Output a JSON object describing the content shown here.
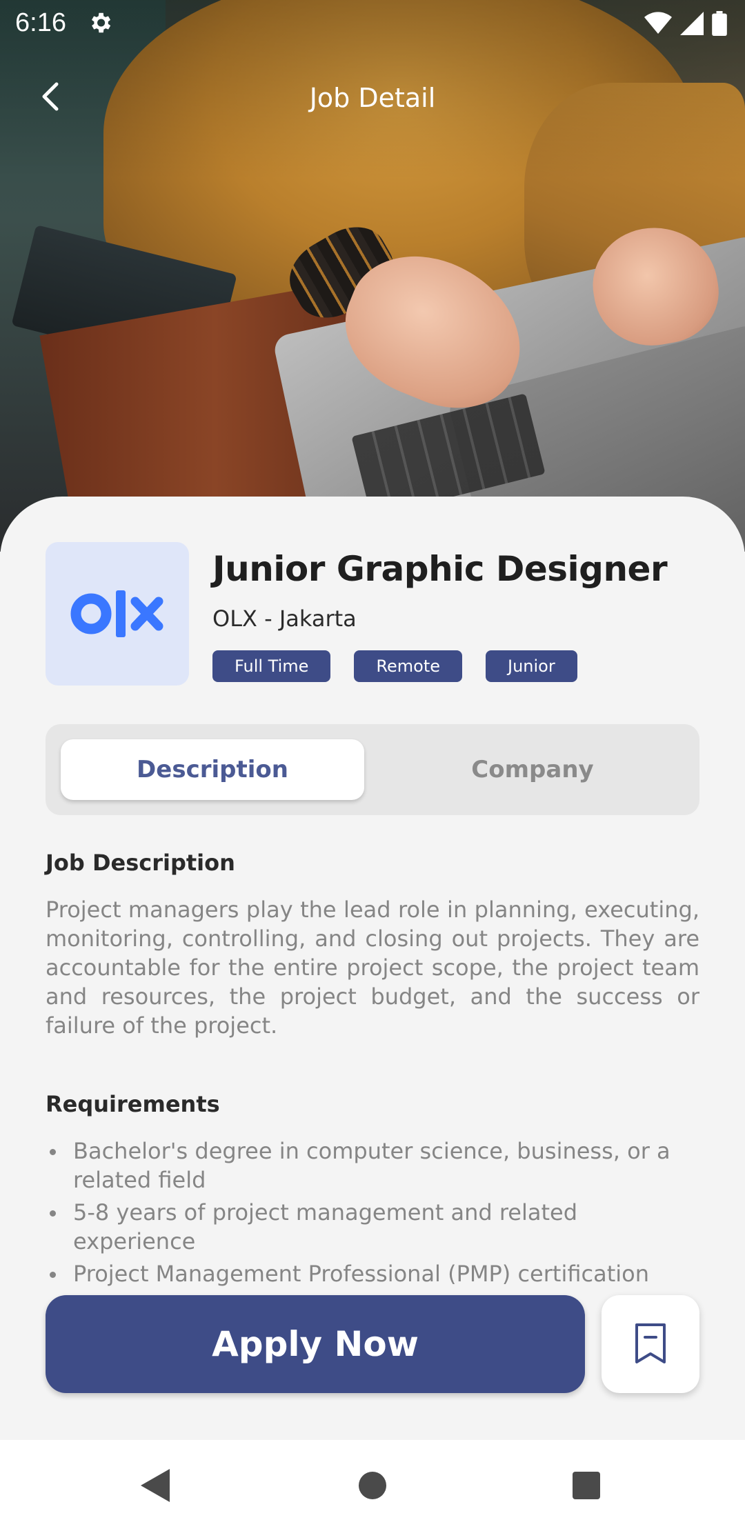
{
  "status_bar": {
    "time": "6:16",
    "icons": [
      "settings-icon",
      "wifi-icon",
      "signal-icon",
      "battery-icon"
    ]
  },
  "top_bar": {
    "title": "Job Detail",
    "back_icon": "chevron-left-icon"
  },
  "job": {
    "title": "Junior Graphic Designer",
    "company_location": "OLX - Jakarta",
    "logo_text": "olx",
    "tags": [
      "Full Time",
      "Remote",
      "Junior"
    ]
  },
  "tabs": {
    "active": "Description",
    "inactive": "Company"
  },
  "description": {
    "heading": "Job Description",
    "body": "Project managers play the lead role in planning, executing, monitoring, controlling, and closing out projects. They are accountable for the entire project scope, the project team and resources, the project budget, and the success or failure of the project."
  },
  "requirements": {
    "heading": "Requirements",
    "items": [
      "Bachelor's degree in computer science, business, or a related field",
      "5-8 years of project management and related experience",
      "Project Management Professional (PMP) certification"
    ]
  },
  "actions": {
    "apply_label": "Apply Now",
    "bookmark_icon": "bookmark-icon"
  },
  "nav": [
    "back-triangle-icon",
    "home-circle-icon",
    "recents-square-icon"
  ],
  "colors": {
    "primary": "#3e4c87",
    "tab_active_text": "#4b5a94",
    "logo_bg": "#dfe6f9",
    "logo_blue": "#3a77ff"
  }
}
